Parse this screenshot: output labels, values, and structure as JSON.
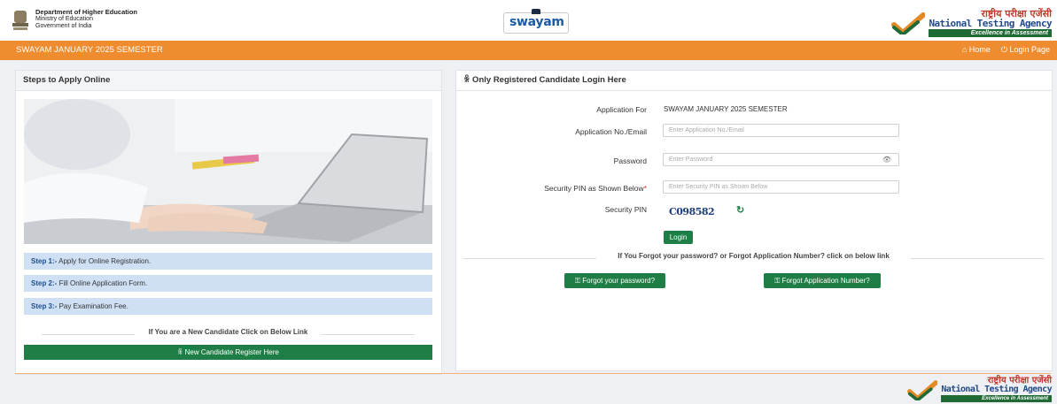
{
  "header": {
    "dept_line1": "Department of Higher Education",
    "dept_line2": "Ministry of Education",
    "dept_line3": "Government of India",
    "swayam_logo": "swayam",
    "nta_hindi": "राष्ट्रीय परीक्षा एजेंसी",
    "nta_english": "National Testing Agency",
    "nta_tagline": "Excellence in Assessment"
  },
  "navbar": {
    "title": "SWAYAM JANUARY 2025 SEMESTER",
    "home": "⌂ Home",
    "login_page": "⏻ Login Page"
  },
  "left_panel": {
    "heading": "Steps to Apply Online",
    "steps": [
      {
        "label": "Step 1:-",
        "text": " Apply for Online Registration."
      },
      {
        "label": "Step 2:-",
        "text": " Fill Online Application Form."
      },
      {
        "label": "Step 3:-",
        "text": " Pay Examination Fee."
      }
    ],
    "new_candidate_text": "If You are a New Candidate Click on Below Link",
    "register_button": "ꆜ New Candidate Register Here"
  },
  "login_panel": {
    "heading": "ꆜ Only Registered Candidate Login Here",
    "application_for_label": "Application For",
    "application_for_value": "SWAYAM JANUARY 2025 SEMESTER",
    "app_no_label": "Application No./Email",
    "app_no_placeholder": "Enter Application No./Email",
    "password_label": "Password",
    "password_placeholder": "Enter Password",
    "pin_label": "Security PIN as Shown Below",
    "pin_placeholder": "Enter Security PIN as Shown Below",
    "security_pin_label": "Security PIN",
    "security_pin_value": "C098582",
    "login_button": "Login",
    "forgot_text": "If You Forgot your password? or Forgot Application Number? click on below link",
    "forgot_password_button": "⚿ Forgot your password?",
    "forgot_appno_button": "⚿ Forgot Application Number?"
  },
  "footer": {
    "nta_hindi": "राष्ट्रीय परीक्षा एजेंसी",
    "nta_english": "National Testing Agency",
    "nta_tagline": "Excellence in Assessment"
  },
  "colors": {
    "orange": "#ef8c2f",
    "green": "#1e7e45",
    "step_bg": "#cfe0f5"
  }
}
